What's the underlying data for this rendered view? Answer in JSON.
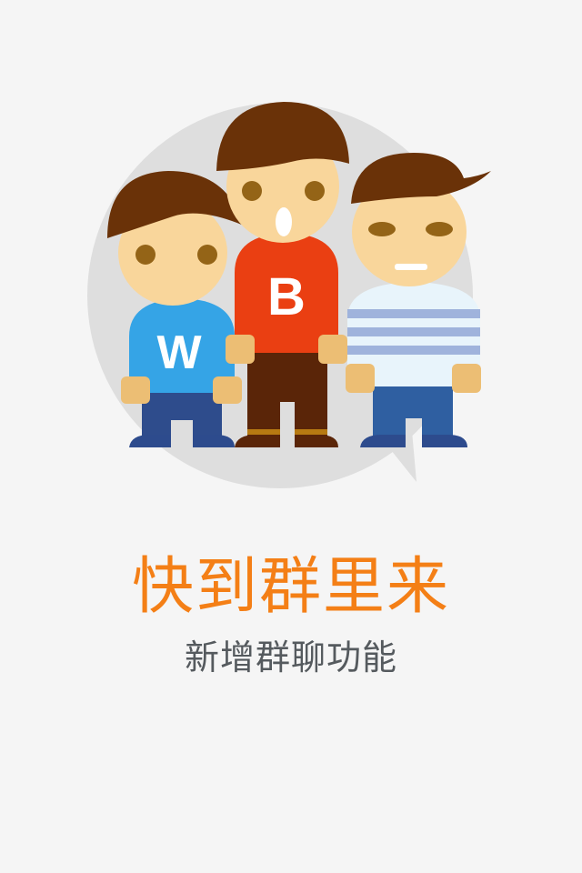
{
  "splash": {
    "title": "快到群里来",
    "subtitle": "新增群聊功能"
  },
  "illustration": {
    "characters": [
      {
        "shirt_letter": "W",
        "shirt_color": "#35a4e6"
      },
      {
        "shirt_letter": "B",
        "shirt_color": "#ea3f12"
      },
      {
        "shirt_letter": "",
        "shirt_color": "#e8f4fb"
      }
    ]
  },
  "colors": {
    "background": "#f5f5f5",
    "title": "#f47f16",
    "subtitle": "#555a5e",
    "bubble": "#dedede",
    "hair": "#6a3208",
    "skin": "#f9d69b"
  }
}
